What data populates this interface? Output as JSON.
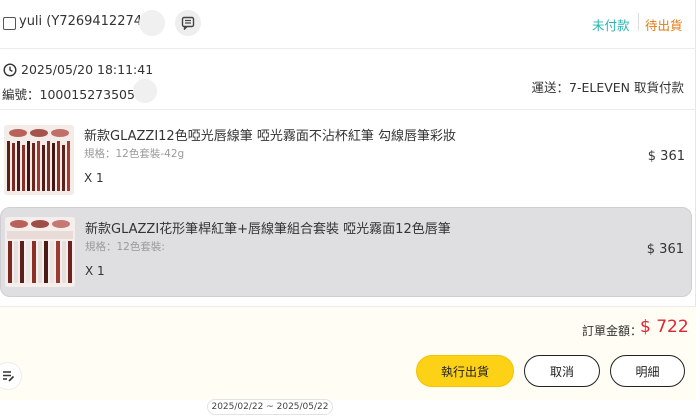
{
  "header": {
    "buyer": "yuli (Y7269412274)",
    "status_payment": "未付款",
    "status_shipping": "待出貨"
  },
  "order": {
    "datetime": "2025/05/20 18:11:41",
    "number": "編號：10001527350570",
    "shipping": "運送：7-ELEVEN 取貨付款"
  },
  "items": [
    {
      "title": "新款GLAZZI12色啞光唇線筆 啞光霧面不沾杯紅筆 勾線唇筆彩妝",
      "spec": "規格：12色套裝-42g",
      "qty": "X 1",
      "price": "$ 361"
    },
    {
      "title": "新款GLAZZI花形筆桿紅筆+唇線筆組合套裝 啞光霧面12色唇筆",
      "spec": "規格：12色套裝:",
      "qty": "X 1",
      "price": "$ 361"
    }
  ],
  "footer": {
    "total_label": "訂單金額：",
    "total_value": "$ 722",
    "ship_button": "執行出貨",
    "cancel_button": "取消",
    "detail_button": "明細"
  },
  "date_range": "2025/02/22 ~ 2025/05/22",
  "colors": {
    "unpaid": "#27b3b0",
    "to_ship": "#e07a16",
    "total": "#e0252f",
    "primary_button": "#fcd116"
  },
  "icons": [
    "chat-icon",
    "clock-icon",
    "edit-note-icon"
  ]
}
